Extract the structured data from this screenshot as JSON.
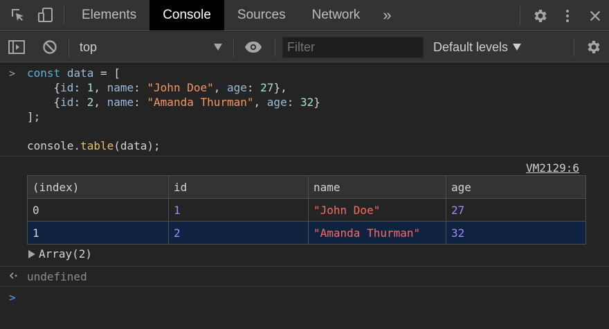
{
  "tabs": {
    "elements": "Elements",
    "console": "Console",
    "sources": "Sources",
    "network": "Network",
    "more": "»"
  },
  "toolbar": {
    "context": "top",
    "filter_placeholder": "Filter",
    "levels": "Default levels"
  },
  "console": {
    "vm_link": "VM2129:6",
    "table": {
      "headers": [
        "(index)",
        "id",
        "name",
        "age"
      ],
      "rows": [
        {
          "index": "0",
          "id": "1",
          "name": "\"John Doe\"",
          "age": "27"
        },
        {
          "index": "1",
          "id": "2",
          "name": "\"Amanda Thurman\"",
          "age": "32"
        }
      ]
    },
    "array_label": "Array(2)",
    "result": "undefined"
  },
  "colors": {
    "background": "#242424",
    "toolbar": "#333333",
    "active_tab": "#000000",
    "selected_row": "#0f2340",
    "prompt_input": "#4e9fff"
  },
  "icons": [
    "inspect-icon",
    "device-toggle-icon",
    "gear-icon",
    "kebab-menu-icon",
    "close-icon",
    "sidebar-toggle-icon",
    "clear-console-icon",
    "eye-icon",
    "caret-down-icon"
  ]
}
